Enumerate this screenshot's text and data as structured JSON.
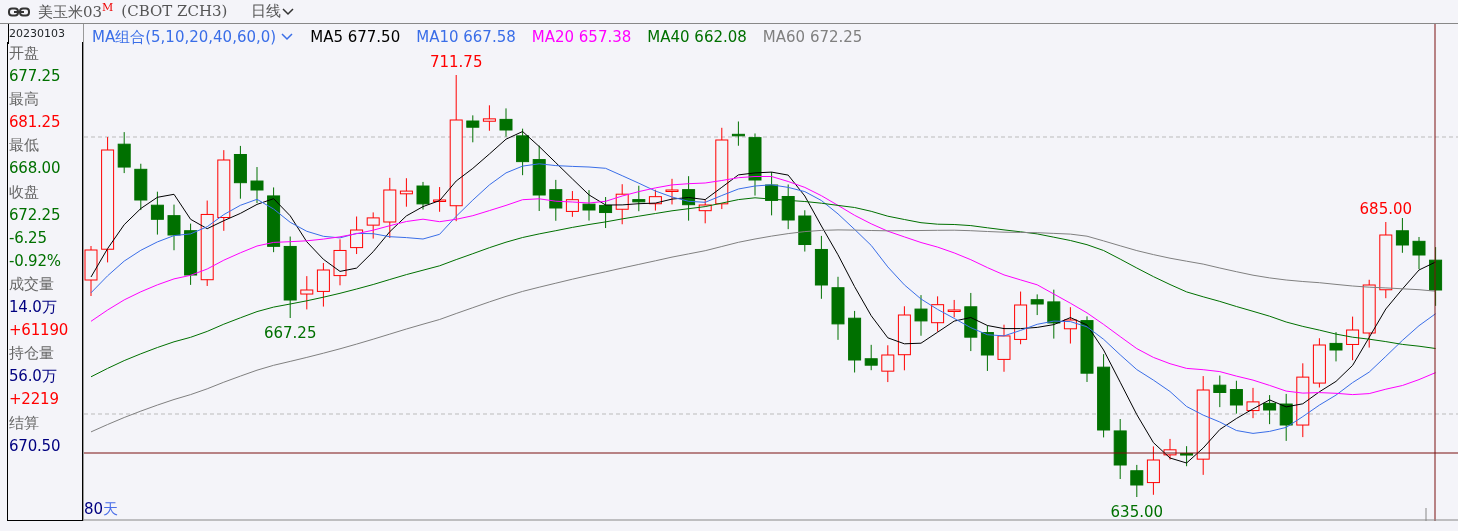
{
  "title_bar": {
    "symbol": "美玉米03",
    "symbol_mark": "M",
    "code": "(CBOT ZCH3)",
    "period": "日线"
  },
  "info_panel": {
    "date": "20230103",
    "rows": [
      {
        "text": "开盘",
        "kind": "label",
        "color": "#666666"
      },
      {
        "text": "677.25",
        "kind": "value",
        "color": "#007000"
      },
      {
        "text": "最高",
        "kind": "label",
        "color": "#666666"
      },
      {
        "text": "681.25",
        "kind": "value",
        "color": "#ff0000"
      },
      {
        "text": "最低",
        "kind": "label",
        "color": "#666666"
      },
      {
        "text": "668.00",
        "kind": "value",
        "color": "#007000"
      },
      {
        "text": "收盘",
        "kind": "label",
        "color": "#666666"
      },
      {
        "text": "672.25",
        "kind": "value",
        "color": "#007000"
      },
      {
        "text": "-6.25",
        "kind": "value",
        "color": "#007000"
      },
      {
        "text": "-0.92%",
        "kind": "value",
        "color": "#007000"
      },
      {
        "text": "成交量",
        "kind": "label",
        "color": "#666666"
      },
      {
        "text": "14.0万",
        "kind": "value",
        "color": "#000080"
      },
      {
        "text": "+61190",
        "kind": "value",
        "color": "#ff0000"
      },
      {
        "text": "持仓量",
        "kind": "label",
        "color": "#666666"
      },
      {
        "text": "56.0万",
        "kind": "value",
        "color": "#000080"
      },
      {
        "text": "+2219",
        "kind": "value",
        "color": "#ff0000"
      },
      {
        "text": "结算",
        "kind": "label",
        "color": "#666666"
      },
      {
        "text": "670.50",
        "kind": "value",
        "color": "#000080"
      }
    ]
  },
  "ma_legend": {
    "selector": "MA组合(5,10,20,40,60,0)",
    "items": [
      {
        "text": "MA5 677.50",
        "color": "#000000"
      },
      {
        "text": "MA10 667.58",
        "color": "#3a6ee8"
      },
      {
        "text": "MA20 657.38",
        "color": "#ff00ff"
      },
      {
        "text": "MA40 662.08",
        "color": "#007000"
      },
      {
        "text": "MA60 672.25",
        "color": "#808080"
      }
    ]
  },
  "price_labels": [
    {
      "text": "711.75",
      "color": "#ff0000"
    },
    {
      "text": "667.25",
      "color": "#007000"
    },
    {
      "text": "635.00",
      "color": "#007000"
    },
    {
      "text": "685.00",
      "color": "#ff0000"
    }
  ],
  "days_label": {
    "count": "80",
    "unit": "天"
  }
}
